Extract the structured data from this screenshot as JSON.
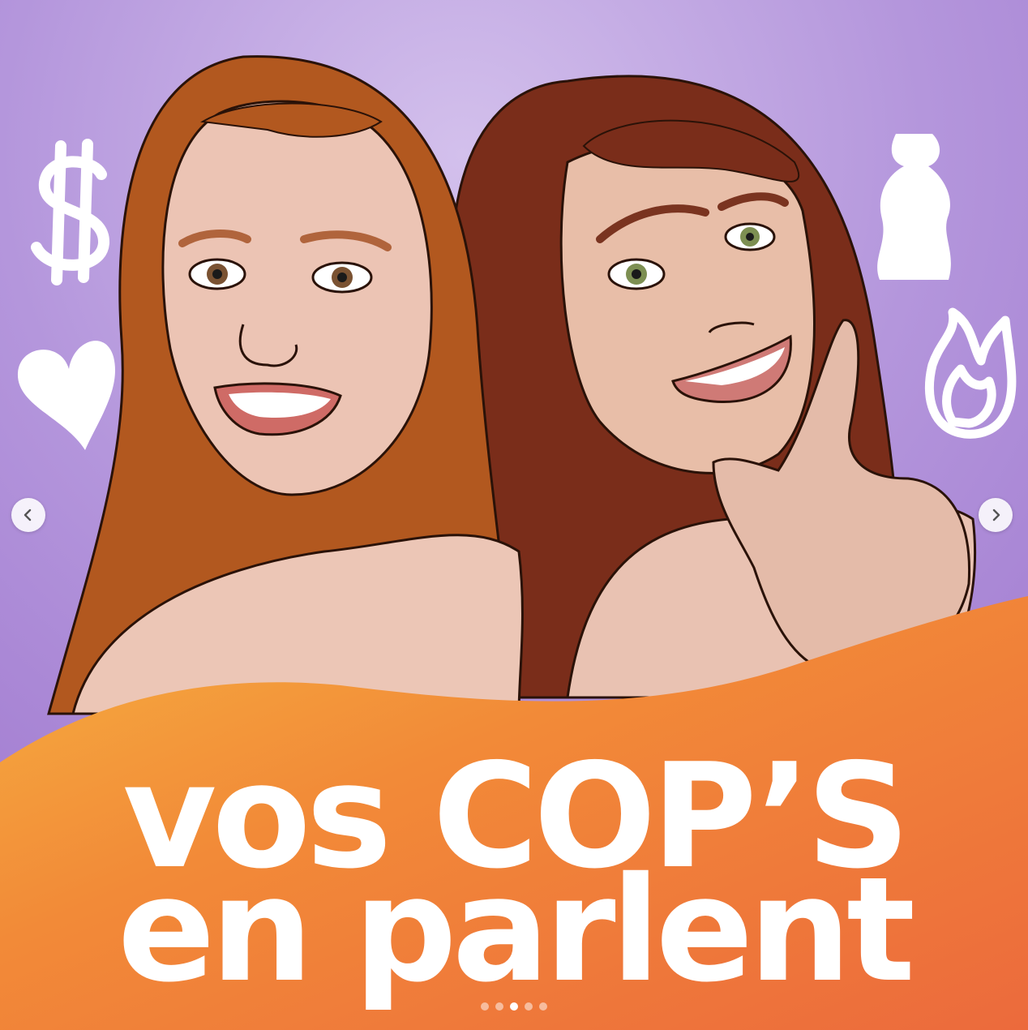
{
  "post": {
    "title_line1": "vos COP’S",
    "title_line2": "en parlent"
  },
  "carousel": {
    "prev_icon": "chevron-left-icon",
    "next_icon": "chevron-right-icon",
    "slide_count": 5,
    "active_index": 2
  },
  "colors": {
    "background_purple": "#b89ad8",
    "banner_orange": "#f07a3a",
    "banner_yellow": "#f5b040",
    "text_white": "#ffffff",
    "hair_left": "#b2581f",
    "hair_right": "#7a2d1a",
    "skin": "#ecc4b4"
  },
  "icons": [
    "dollar-icon",
    "heart-icon",
    "torso-icon",
    "flame-icon"
  ]
}
